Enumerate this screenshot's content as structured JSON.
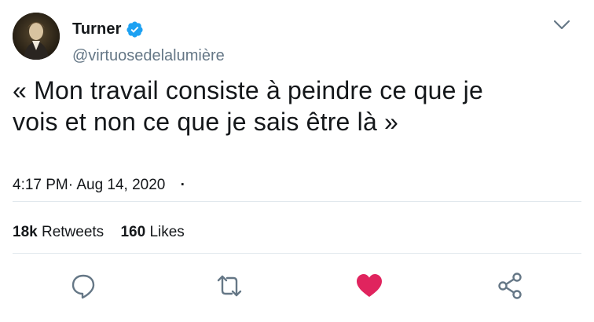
{
  "author": {
    "name": "Turner",
    "handle": "@virtuosedelalumière",
    "verified": true
  },
  "tweet": {
    "text_line1": "« Mon travail consiste à peindre ce que je",
    "text_line2": "vois et non ce que je sais être là »",
    "time": "4:17 PM·",
    "date": "Aug 14, 2020",
    "separator": "·"
  },
  "stats": {
    "retweets_count": "18k",
    "retweets_label": "Retweets",
    "likes_count": "160",
    "likes_label": "Likes"
  },
  "actions": {
    "reply_icon": "reply-icon",
    "retweet_icon": "retweet-icon",
    "like_icon": "heart-icon",
    "share_icon": "share-icon"
  },
  "colors": {
    "like": "#e0245e",
    "verified": "#1da1f2",
    "icon": "#657786"
  }
}
